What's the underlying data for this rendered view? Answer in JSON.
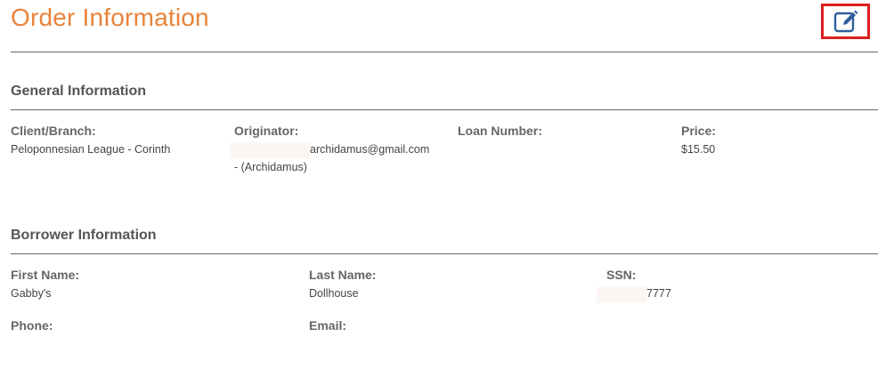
{
  "header": {
    "title": "Order Information",
    "edit_icon": "edit-icon"
  },
  "general": {
    "section_title": "General Information",
    "client_branch": {
      "label": "Client/Branch:",
      "value": "Peloponnesian League - Corinth"
    },
    "originator": {
      "label": "Originator:",
      "email": "archidamus@gmail.com",
      "name": "- (Archidamus)"
    },
    "loan_number": {
      "label": "Loan Number:",
      "value": ""
    },
    "price": {
      "label": "Price:",
      "value": "$15.50"
    }
  },
  "borrower": {
    "section_title": "Borrower Information",
    "first_name": {
      "label": "First Name:",
      "value": "Gabby's"
    },
    "last_name": {
      "label": "Last Name:",
      "value": "Dollhouse"
    },
    "ssn": {
      "label": "SSN:",
      "value": "7777"
    },
    "phone": {
      "label": "Phone:",
      "value": ""
    },
    "email": {
      "label": "Email:",
      "value": ""
    }
  },
  "colors": {
    "title": "#e8833a",
    "highlight_border": "#e01e1e",
    "icon": "#2f5f9e"
  }
}
